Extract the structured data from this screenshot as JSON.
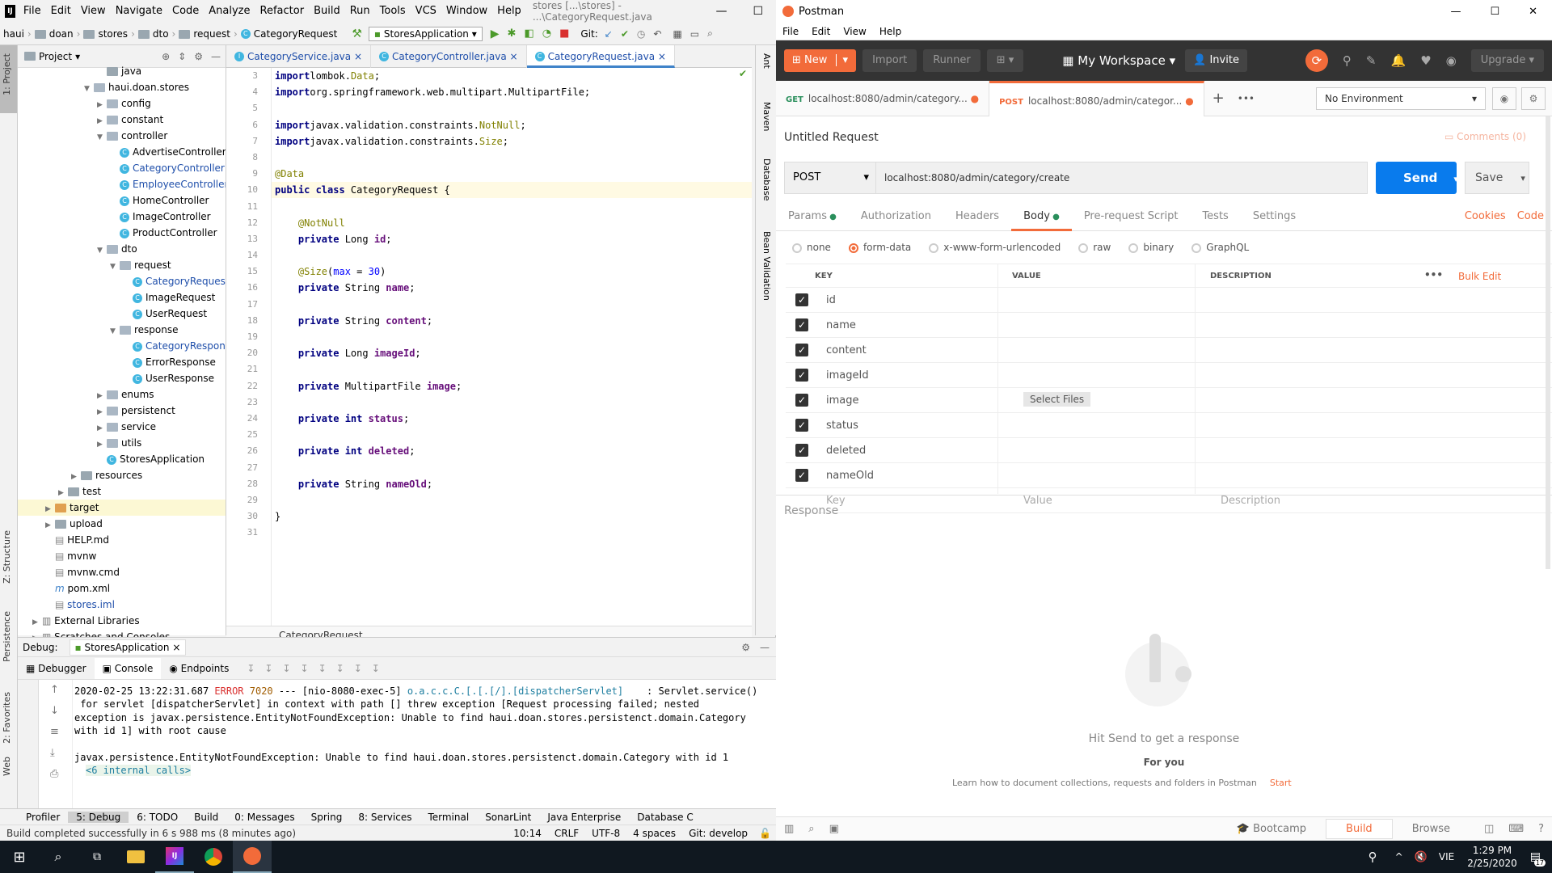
{
  "ij": {
    "menu": [
      "File",
      "Edit",
      "View",
      "Navigate",
      "Code",
      "Analyze",
      "Refactor",
      "Build",
      "Run",
      "Tools",
      "VCS",
      "Window",
      "Help"
    ],
    "title": "stores [...\\stores] - ...\\CategoryRequest.java",
    "nav": {
      "c1": "haui",
      "c2": "doan",
      "c3": "stores",
      "c4": "dto",
      "c5": "request",
      "c6": "CategoryRequest",
      "run_config": "StoresApplication",
      "git": "Git:"
    },
    "leftbar": {
      "project": "1: Project",
      "structure": "Z: Structure",
      "persistence": "Persistence",
      "favorites": "2: Favorites",
      "web": "Web"
    },
    "project": {
      "header": "Project",
      "tree": [
        {
          "t": "java",
          "d": 4,
          "k": "f"
        },
        {
          "t": "haui.doan.stores",
          "d": 3,
          "k": "pkg",
          "o": "v"
        },
        {
          "t": "config",
          "d": 4,
          "k": "pkg",
          "o": ">"
        },
        {
          "t": "constant",
          "d": 4,
          "k": "pkg",
          "o": ">"
        },
        {
          "t": "controller",
          "d": 4,
          "k": "pkg",
          "o": "v"
        },
        {
          "t": "AdvertiseController",
          "d": 5,
          "k": "c"
        },
        {
          "t": "CategoryController",
          "d": 5,
          "k": "c",
          "hl": 1
        },
        {
          "t": "EmployeeController",
          "d": 5,
          "k": "c",
          "hl": 2
        },
        {
          "t": "HomeController",
          "d": 5,
          "k": "c"
        },
        {
          "t": "ImageController",
          "d": 5,
          "k": "c"
        },
        {
          "t": "ProductController",
          "d": 5,
          "k": "c"
        },
        {
          "t": "dto",
          "d": 4,
          "k": "pkg",
          "o": "v"
        },
        {
          "t": "request",
          "d": 5,
          "k": "pkg",
          "o": "v"
        },
        {
          "t": "CategoryRequest",
          "d": 6,
          "k": "c",
          "hl": 1
        },
        {
          "t": "ImageRequest",
          "d": 6,
          "k": "c"
        },
        {
          "t": "UserRequest",
          "d": 6,
          "k": "c"
        },
        {
          "t": "response",
          "d": 5,
          "k": "pkg",
          "o": "v"
        },
        {
          "t": "CategoryResponse",
          "d": 6,
          "k": "c",
          "hl": 1
        },
        {
          "t": "ErrorResponse",
          "d": 6,
          "k": "c"
        },
        {
          "t": "UserResponse",
          "d": 6,
          "k": "c"
        },
        {
          "t": "enums",
          "d": 4,
          "k": "pkg",
          "o": ">"
        },
        {
          "t": "persistenct",
          "d": 4,
          "k": "pkg",
          "o": ">"
        },
        {
          "t": "service",
          "d": 4,
          "k": "pkg",
          "o": ">"
        },
        {
          "t": "utils",
          "d": 4,
          "k": "pkg",
          "o": ">"
        },
        {
          "t": "StoresApplication",
          "d": 4,
          "k": "app"
        },
        {
          "t": "resources",
          "d": 2,
          "k": "f",
          "o": ">"
        },
        {
          "t": "test",
          "d": 1,
          "k": "f",
          "o": ">"
        },
        {
          "t": "target",
          "d": 0,
          "k": "fo",
          "o": ">"
        },
        {
          "t": "upload",
          "d": 0,
          "k": "f",
          "o": ">"
        },
        {
          "t": "HELP.md",
          "d": 0,
          "k": "file"
        },
        {
          "t": "mvnw",
          "d": 0,
          "k": "file"
        },
        {
          "t": "mvnw.cmd",
          "d": 0,
          "k": "file"
        },
        {
          "t": "pom.xml",
          "d": 0,
          "k": "m"
        },
        {
          "t": "stores.iml",
          "d": 0,
          "k": "file",
          "hl": 2
        },
        {
          "t": "External Libraries",
          "d": -1,
          "k": "lib",
          "o": ">"
        },
        {
          "t": "Scratches and Consoles",
          "d": -1,
          "k": "lib",
          "o": ">"
        }
      ]
    },
    "tabs": [
      "CategoryService.java",
      "CategoryController.java",
      "CategoryRequest.java"
    ],
    "line_numbers": [
      "3",
      "4",
      "5",
      "6",
      "7",
      "8",
      "9",
      "10",
      "11",
      "12",
      "13",
      "14",
      "15",
      "16",
      "17",
      "18",
      "19",
      "20",
      "21",
      "22",
      "23",
      "24",
      "25",
      "26",
      "27",
      "28",
      "29",
      "30",
      "31"
    ],
    "code": [
      [
        [
          "kw",
          "import"
        ],
        [
          "",
          "lombok."
        ],
        [
          "an",
          "Data"
        ],
        [
          "",
          ";"
        ]
      ],
      [
        [
          "kw",
          "import"
        ],
        [
          "",
          "org.springframework.web.multipart.MultipartFile;"
        ]
      ],
      [],
      [
        [
          "kw",
          "import"
        ],
        [
          "",
          "javax.validation.constraints."
        ],
        [
          "an",
          "NotNull"
        ],
        [
          "",
          ";"
        ]
      ],
      [
        [
          "kw",
          "import"
        ],
        [
          "",
          "javax.validation.constraints."
        ],
        [
          "an",
          "Size"
        ],
        [
          "",
          ";"
        ]
      ],
      [],
      [
        [
          "an",
          "@Data"
        ]
      ],
      [
        [
          "kw",
          "public class"
        ],
        [
          "",
          " CategoryRequest {"
        ]
      ],
      [],
      [
        [
          "an",
          "    @NotNull"
        ]
      ],
      [
        [
          "kw",
          "    private"
        ],
        [
          "",
          " Long "
        ],
        [
          "fld",
          "id"
        ],
        [
          "",
          ";"
        ]
      ],
      [],
      [
        [
          "an",
          "    @Size"
        ],
        [
          "",
          "("
        ],
        [
          "num",
          "max"
        ],
        [
          "",
          " = "
        ],
        [
          "num",
          "30"
        ],
        [
          "",
          ")"
        ]
      ],
      [
        [
          "kw",
          "    private"
        ],
        [
          "",
          " String "
        ],
        [
          "fld",
          "name"
        ],
        [
          "",
          ";"
        ]
      ],
      [],
      [
        [
          "kw",
          "    private"
        ],
        [
          "",
          " String "
        ],
        [
          "fld",
          "content"
        ],
        [
          "",
          ";"
        ]
      ],
      [],
      [
        [
          "kw",
          "    private"
        ],
        [
          "",
          " Long "
        ],
        [
          "fld",
          "imageId"
        ],
        [
          "",
          ";"
        ]
      ],
      [],
      [
        [
          "kw",
          "    private"
        ],
        [
          "",
          " MultipartFile "
        ],
        [
          "fld",
          "image"
        ],
        [
          "",
          ";"
        ]
      ],
      [],
      [
        [
          "kw",
          "    private int"
        ],
        [
          "",
          " "
        ],
        [
          "fld",
          "status"
        ],
        [
          "",
          ";"
        ]
      ],
      [],
      [
        [
          "kw",
          "    private int"
        ],
        [
          "",
          " "
        ],
        [
          "fld",
          "deleted"
        ],
        [
          "",
          ";"
        ]
      ],
      [],
      [
        [
          "kw",
          "    private"
        ],
        [
          "",
          " String "
        ],
        [
          "fld",
          "nameOld"
        ],
        [
          "",
          ";"
        ]
      ],
      [],
      [
        [
          "",
          "}"
        ]
      ],
      []
    ],
    "crumb": "CategoryRequest",
    "rightbar": {
      "ant": "Ant",
      "maven": "Maven",
      "database": "Database",
      "bean": "Bean Validation"
    },
    "debug": {
      "label": "Debug:",
      "config": "StoresApplication",
      "tabs": [
        "Debugger",
        "Console",
        "Endpoints"
      ],
      "lines": [
        {
          "ts": "2020-02-25 13:22:31.687 ",
          "lvl": "ERROR",
          "pid": " 7020",
          "rest": " --- [nio-8080-exec-5] ",
          "logger": "o.a.c.c.C.[.[.[/].[dispatcherServlet]",
          "msg": "    : Servlet.service()"
        },
        {
          "text": " for servlet [dispatcherServlet] in context with path [] threw exception [Request processing failed; nested"
        },
        {
          "text": "exception is javax.persistence.EntityNotFoundException: Unable to find haui.doan.stores.persistenct.domain.Category"
        },
        {
          "text": "with id 1] with root cause"
        },
        {
          "text": ""
        },
        {
          "text": "javax.persistence.EntityNotFoundException: Unable to find haui.doan.stores.persistenct.domain.Category with id 1"
        },
        {
          "text": "<6 internal calls>"
        }
      ]
    },
    "bottom_tabs": [
      "Profiler",
      "5: Debug",
      "6: TODO",
      "Build",
      "0: Messages",
      "Spring",
      "8: Services",
      "Terminal",
      "SonarLint",
      "Java Enterprise",
      "Database C"
    ],
    "status": {
      "msg": "Build completed successfully in 6 s 988 ms (8 minutes ago)",
      "pos": "10:14",
      "sep": "CRLF",
      "enc": "UTF-8",
      "indent": "4 spaces",
      "git": "Git: develop"
    }
  },
  "pm": {
    "title": "Postman",
    "menu": [
      "File",
      "Edit",
      "View",
      "Help"
    ],
    "top": {
      "new": "New",
      "import": "Import",
      "runner": "Runner",
      "workspace": "My Workspace",
      "invite": "Invite",
      "upgrade": "Upgrade"
    },
    "req_tabs": [
      {
        "method": "GET",
        "url": "localhost:8080/admin/category..."
      },
      {
        "method": "POST",
        "url": "localhost:8080/admin/categor..."
      }
    ],
    "env": "No Environment",
    "request_title": "Untitled Request",
    "comments": "Comments (0)",
    "method": "POST",
    "url": "localhost:8080/admin/category/create",
    "send": "Send",
    "save": "Save",
    "sub_tabs": [
      "Params",
      "Authorization",
      "Headers",
      "Body",
      "Pre-request Script",
      "Tests",
      "Settings"
    ],
    "cookies": "Cookies",
    "code": "Code",
    "body_types": [
      "none",
      "form-data",
      "x-www-form-urlencoded",
      "raw",
      "binary",
      "GraphQL"
    ],
    "cols": {
      "key": "KEY",
      "value": "VALUE",
      "desc": "DESCRIPTION",
      "bulk": "Bulk Edit"
    },
    "rows": [
      "id",
      "name",
      "content",
      "imageId",
      "image",
      "status",
      "deleted",
      "nameOld"
    ],
    "select_files": "Select Files",
    "ph": {
      "key": "Key",
      "value": "Value",
      "desc": "Description"
    },
    "response": "Response",
    "hit_send": "Hit Send to get a response",
    "for_you": "For you",
    "learn": "Learn how to document collections, requests and folders in Postman",
    "start": "Start",
    "foot": {
      "bootcamp": "Bootcamp",
      "build": "Build",
      "browse": "Browse"
    }
  },
  "taskbar": {
    "lang": "VIE",
    "time": "1:29 PM",
    "date": "2/25/2020",
    "notif": "17"
  },
  "colors": {
    "postman_orange": "#f26b3a",
    "send_blue": "#097bed",
    "intellij_link": "#1e4eaa"
  }
}
